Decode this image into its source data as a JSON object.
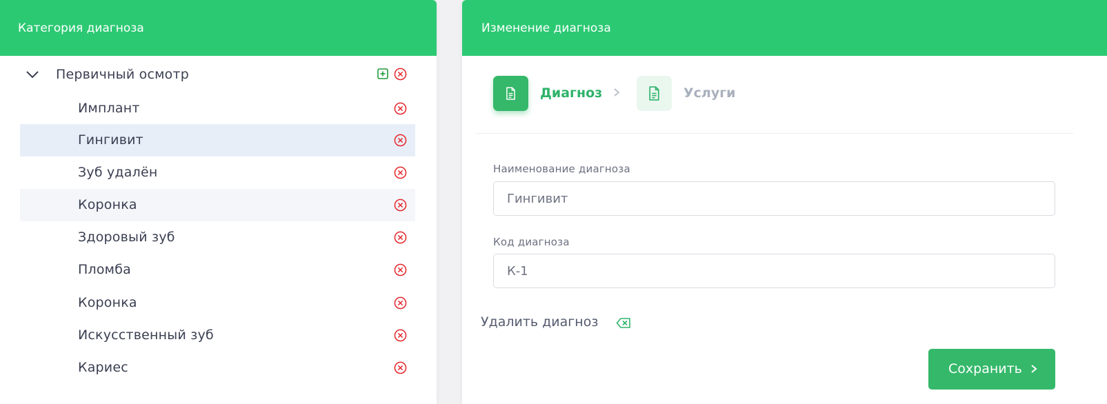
{
  "left_panel": {
    "title": "Категория диагноза",
    "tree": {
      "root_label": "Первичный осмотр",
      "items": [
        {
          "label": "Имплант"
        },
        {
          "label": "Гингивит"
        },
        {
          "label": "Зуб удалён"
        },
        {
          "label": "Коронка"
        },
        {
          "label": "Здоровый зуб"
        },
        {
          "label": "Пломба"
        },
        {
          "label": "Коронка"
        },
        {
          "label": "Искусственный зуб"
        },
        {
          "label": "Кариес"
        }
      ],
      "selected_index": 1,
      "hovered_index": 3
    }
  },
  "right_panel": {
    "title": "Изменение диагноза",
    "steps": [
      {
        "label": "Диагноз",
        "icon": "document-icon",
        "active": true
      },
      {
        "label": "Услуги",
        "icon": "document-icon",
        "active": false
      }
    ],
    "fields": {
      "name": {
        "label": "Наименование диагноза",
        "value": "Гингивит"
      },
      "code": {
        "label": "Код диагноза",
        "value": "К-1"
      }
    },
    "delete_label": "Удалить диагноз",
    "save_label": "Сохранить"
  },
  "colors": {
    "header_green": "#2cc973",
    "button_green": "#35b86a",
    "delete_red": "#e5262b",
    "selected_row": "#e8eef8"
  }
}
